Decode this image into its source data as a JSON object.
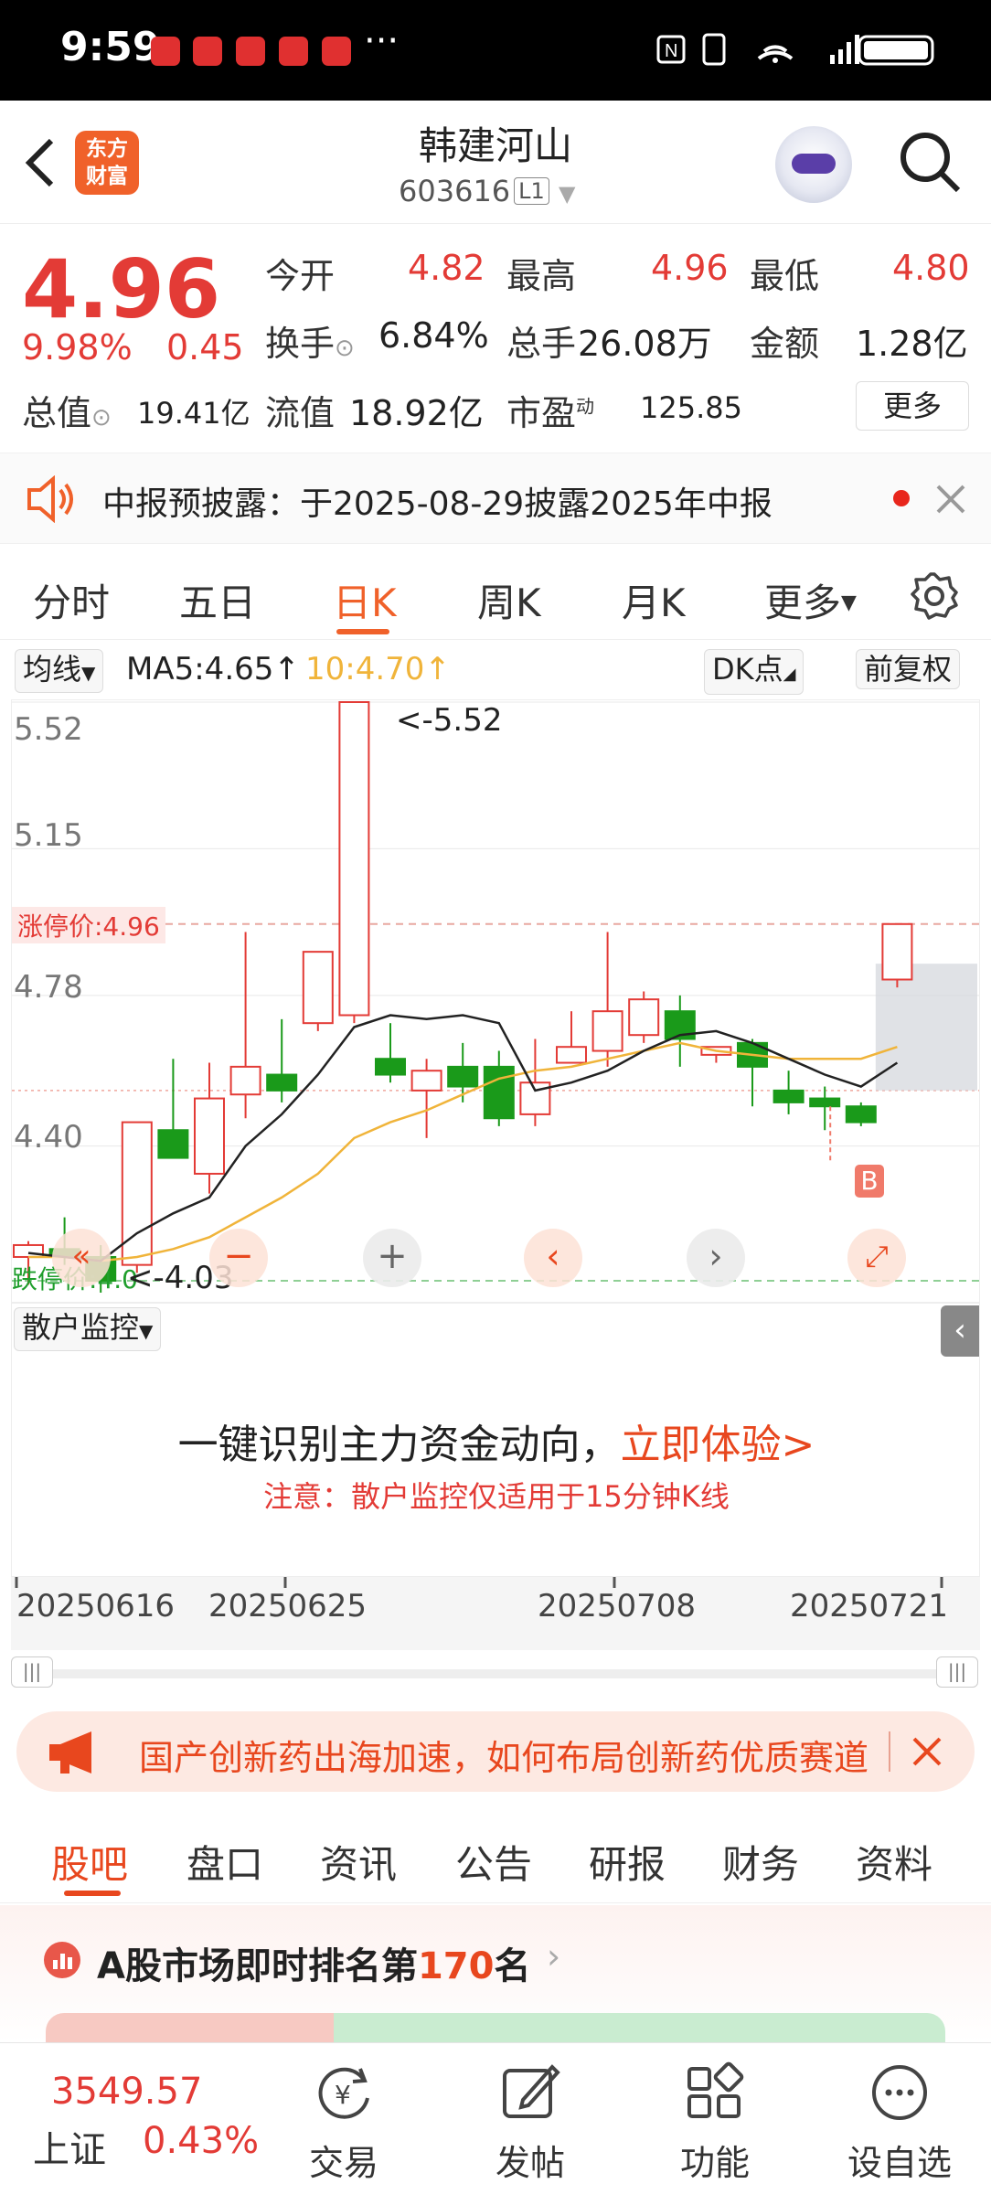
{
  "status_bar": {
    "time": "9:59",
    "dots": "···"
  },
  "header": {
    "stock_name": "韩建河山",
    "stock_code": "603616",
    "level": "L1",
    "logo_line1": "东方",
    "logo_line2": "财富"
  },
  "quote": {
    "price": "4.96",
    "change_pct": "9.98%",
    "change": "0.45",
    "open_label": "今开",
    "open": "4.82",
    "high_label": "最高",
    "high": "4.96",
    "low_label": "最低",
    "low": "4.80",
    "turnover_label": "换手",
    "turnover": "6.84%",
    "volume_label": "总手",
    "volume": "26.08万",
    "amount_label": "金额",
    "amount": "1.28亿",
    "mktcap_label": "总值",
    "mktcap": "19.41亿",
    "float_label": "流值",
    "float": "18.92亿",
    "pe_label": "市盈",
    "pe_sup": "动",
    "pe": "125.85",
    "more": "更多"
  },
  "notice": {
    "text": "中报预披露：于2025-08-29披露2025年中报"
  },
  "tabs": [
    "分时",
    "五日",
    "日K",
    "周K",
    "月K",
    "更多"
  ],
  "ma_bar": {
    "indicator": "均线",
    "ma5": "MA5:4.65↑",
    "ma10": "10:4.70↑",
    "dk": "DK点",
    "adjust": "前复权"
  },
  "chart": {
    "y_labels": [
      "5.52",
      "5.15",
      "4.78",
      "4.40"
    ],
    "limit_up": "涨停价:4.96",
    "limit_down": "跌停价:4.0",
    "max_label": "<-5.52",
    "min_label": "<-4.03",
    "b_marker": "B",
    "colors": {
      "up": "#e33b36",
      "down": "#1a9a1a",
      "ma5": "#222222",
      "ma10": "#f0b43a"
    }
  },
  "chart_data": {
    "type": "candlestick",
    "ylim": [
      4.03,
      5.52
    ],
    "candles": [
      {
        "o": 4.12,
        "h": 4.16,
        "l": 4.05,
        "c": 4.15
      },
      {
        "o": 4.14,
        "h": 4.22,
        "l": 4.1,
        "c": 4.12
      },
      {
        "o": 4.12,
        "h": 4.15,
        "l": 4.03,
        "c": 4.06
      },
      {
        "o": 4.1,
        "h": 4.46,
        "l": 4.08,
        "c": 4.46
      },
      {
        "o": 4.44,
        "h": 4.62,
        "l": 4.37,
        "c": 4.37
      },
      {
        "o": 4.33,
        "h": 4.61,
        "l": 4.28,
        "c": 4.52
      },
      {
        "o": 4.53,
        "h": 4.94,
        "l": 4.47,
        "c": 4.6
      },
      {
        "o": 4.58,
        "h": 4.72,
        "l": 4.51,
        "c": 4.54
      },
      {
        "o": 4.71,
        "h": 4.89,
        "l": 4.69,
        "c": 4.89
      },
      {
        "o": 4.73,
        "h": 5.52,
        "l": 4.71,
        "c": 5.52
      },
      {
        "o": 4.62,
        "h": 4.71,
        "l": 4.56,
        "c": 4.58
      },
      {
        "o": 4.54,
        "h": 4.62,
        "l": 4.42,
        "c": 4.59
      },
      {
        "o": 4.6,
        "h": 4.66,
        "l": 4.51,
        "c": 4.55
      },
      {
        "o": 4.6,
        "h": 4.64,
        "l": 4.45,
        "c": 4.47
      },
      {
        "o": 4.48,
        "h": 4.67,
        "l": 4.45,
        "c": 4.56
      },
      {
        "o": 4.61,
        "h": 4.74,
        "l": 4.61,
        "c": 4.65
      },
      {
        "o": 4.64,
        "h": 4.94,
        "l": 4.6,
        "c": 4.74
      },
      {
        "o": 4.68,
        "h": 4.79,
        "l": 4.66,
        "c": 4.77
      },
      {
        "o": 4.74,
        "h": 4.78,
        "l": 4.6,
        "c": 4.67
      },
      {
        "o": 4.63,
        "h": 4.65,
        "l": 4.61,
        "c": 4.65
      },
      {
        "o": 4.66,
        "h": 4.67,
        "l": 4.5,
        "c": 4.6
      },
      {
        "o": 4.54,
        "h": 4.59,
        "l": 4.48,
        "c": 4.51
      },
      {
        "o": 4.52,
        "h": 4.55,
        "l": 4.44,
        "c": 4.5
      },
      {
        "o": 4.5,
        "h": 4.51,
        "l": 4.45,
        "c": 4.46
      },
      {
        "o": 4.82,
        "h": 4.96,
        "l": 4.8,
        "c": 4.96
      }
    ],
    "ma5": [
      4.13,
      4.12,
      4.11,
      4.18,
      4.23,
      4.27,
      4.4,
      4.48,
      4.58,
      4.7,
      4.73,
      4.72,
      4.73,
      4.71,
      4.54,
      4.56,
      4.59,
      4.64,
      4.68,
      4.69,
      4.66,
      4.62,
      4.58,
      4.55,
      4.61
    ],
    "ma10": [
      4.12,
      4.12,
      4.11,
      4.12,
      4.14,
      4.17,
      4.22,
      4.27,
      4.33,
      4.42,
      4.46,
      4.49,
      4.53,
      4.57,
      4.59,
      4.6,
      4.62,
      4.64,
      4.66,
      4.64,
      4.63,
      4.62,
      4.62,
      4.62,
      4.65
    ]
  },
  "retail": {
    "title": "散户监控",
    "headline": "一键识别主力资金动向，",
    "cta": "立即体验>",
    "note": "注意：散户监控仅适用于15分钟K线"
  },
  "dates": [
    "20250616",
    "20250625",
    "20250708",
    "20250721"
  ],
  "banner": {
    "text": "国产创新药出海加速，如何布局创新药优质赛道"
  },
  "bottom_tabs": [
    "股吧",
    "盘口",
    "资讯",
    "公告",
    "研报",
    "财务",
    "资料"
  ],
  "rank": {
    "prefix": "A股市场即时排名第",
    "rank": "170",
    "suffix": "名"
  },
  "nav": {
    "index_value": "3549.57",
    "index_name": "上证",
    "index_change": "0.43%",
    "items": [
      "交易",
      "发帖",
      "功能",
      "设自选"
    ]
  }
}
